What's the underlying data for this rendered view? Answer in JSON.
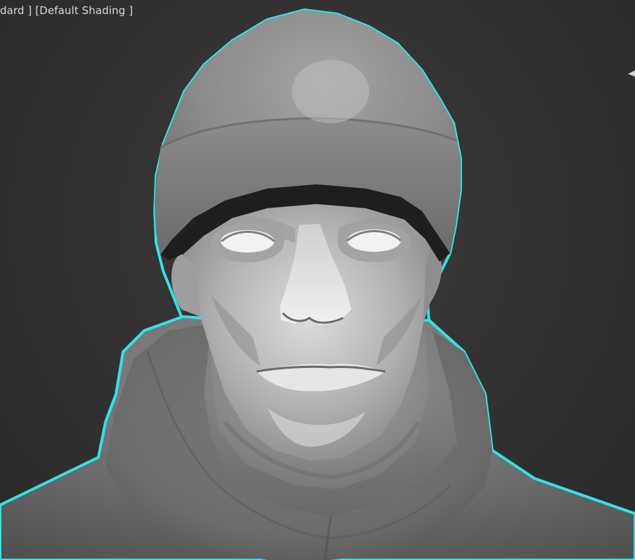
{
  "viewport": {
    "labels": {
      "view_mode": "dard ]",
      "shading_mode": "[Default Shading ]"
    }
  },
  "scene": {
    "selection_outline_color": "#2fe3e8",
    "background_color": "#333333",
    "model_shade_color": "#9a9a9a",
    "selected_object": "character-bust"
  }
}
